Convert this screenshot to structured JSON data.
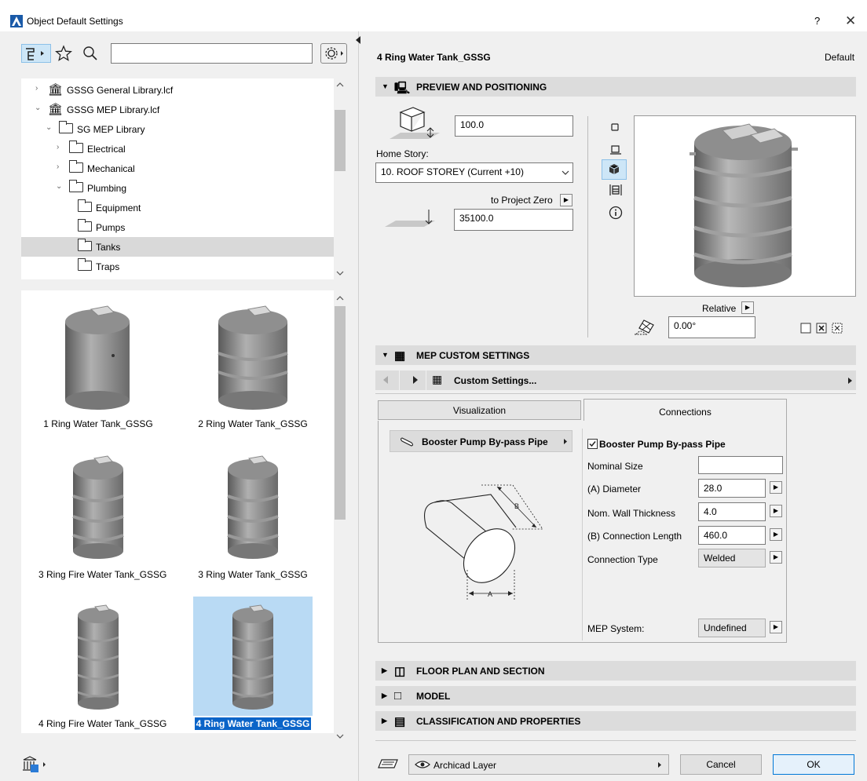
{
  "window": {
    "title": "Object Default Settings",
    "help": "?",
    "close": "✕"
  },
  "toolbar": {
    "search_placeholder": ""
  },
  "tree": [
    {
      "label": "GSSG General Library.lcf",
      "level": 1,
      "expanded": false,
      "type": "library"
    },
    {
      "label": "GSSG MEP Library.lcf",
      "level": 1,
      "expanded": true,
      "type": "library"
    },
    {
      "label": "SG MEP Library",
      "level": 2,
      "expanded": true,
      "type": "folder"
    },
    {
      "label": "Electrical",
      "level": 3,
      "expanded": false,
      "type": "folder"
    },
    {
      "label": "Mechanical",
      "level": 3,
      "expanded": false,
      "type": "folder"
    },
    {
      "label": "Plumbing",
      "level": 3,
      "expanded": true,
      "type": "folder"
    },
    {
      "label": "Equipment",
      "level": 4,
      "type": "folder"
    },
    {
      "label": "Pumps",
      "level": 4,
      "type": "folder"
    },
    {
      "label": "Tanks",
      "level": 4,
      "type": "folder",
      "selected": true
    },
    {
      "label": "Traps",
      "level": 4,
      "type": "folder"
    }
  ],
  "gallery": [
    {
      "label": "1 Ring Water Tank_GSSG",
      "rings": 0
    },
    {
      "label": "2 Ring Water Tank_GSSG",
      "rings": 2
    },
    {
      "label": "3 Ring Fire Water Tank_GSSG",
      "rings": 3
    },
    {
      "label": "3 Ring Water Tank_GSSG",
      "rings": 3
    },
    {
      "label": "4 Ring Fire Water Tank_GSSG",
      "rings": 4
    },
    {
      "label": "4 Ring Water Tank_GSSG",
      "rings": 4,
      "selected": true
    }
  ],
  "header": {
    "object_name": "4 Ring Water Tank_GSSG",
    "default_label": "Default"
  },
  "preview_positioning": {
    "section_title": "PREVIEW AND POSITIONING",
    "height_value": "100.0",
    "home_story_label": "Home Story:",
    "home_story_value": "10. ROOF STOREY (Current +10)",
    "to_project_zero": "to Project Zero",
    "elevation_value": "35100.0",
    "relative_label": "Relative",
    "angle_value": "0.00°"
  },
  "mep_custom": {
    "section_title": "MEP CUSTOM SETTINGS",
    "custom_settings_label": "Custom Settings...",
    "tabs": [
      "Visualization",
      "Connections"
    ],
    "active_tab": "Connections",
    "connection_item": "Booster Pump By-pass Pipe",
    "checkbox_label": "Booster Pump By-pass Pipe",
    "diagram_labels": {
      "b": "B",
      "a": "A"
    },
    "fields": [
      {
        "label": "Nominal Size",
        "value": ""
      },
      {
        "label": "(A) Diameter",
        "value": "28.0"
      },
      {
        "label": "Nom. Wall Thickness",
        "value": "4.0"
      },
      {
        "label": "(B) Connection Length",
        "value": "460.0"
      },
      {
        "label": "Connection Type",
        "value": "Welded"
      }
    ],
    "mep_system_label": "MEP System:",
    "mep_system_value": "Undefined"
  },
  "sections": [
    {
      "title": "FLOOR PLAN AND SECTION"
    },
    {
      "title": "MODEL"
    },
    {
      "title": "CLASSIFICATION AND PROPERTIES"
    }
  ],
  "footer": {
    "layer": "Archicad Layer",
    "cancel": "Cancel",
    "ok": "OK"
  }
}
